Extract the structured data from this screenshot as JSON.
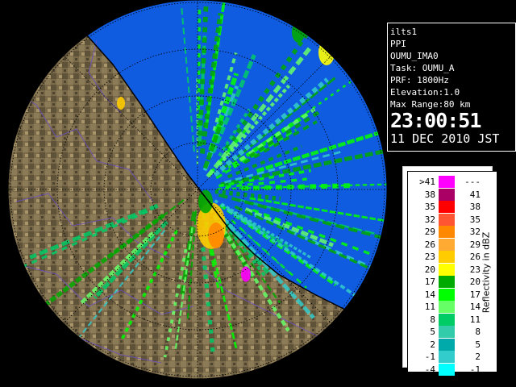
{
  "info": {
    "station": "ilts1",
    "product": "PPI",
    "site": "OUMU_IMA0",
    "task": "Task: OUMU_A",
    "prf": "PRF: 1800Hz",
    "elevation": "Elevation:1.0",
    "max_range": "Max Range:80 km",
    "time": "23:00:51",
    "date": "11 DEC 2010 JST"
  },
  "legend": {
    "unit": "Reflectivity in dBZ",
    "rows": [
      {
        "low": ">41",
        "high": "---",
        "color": "#ff00ff"
      },
      {
        "low": "38",
        "high": "41",
        "color": "#aa0066"
      },
      {
        "low": "35",
        "high": "38",
        "color": "#ff0000"
      },
      {
        "low": "32",
        "high": "35",
        "color": "#ff5533"
      },
      {
        "low": "29",
        "high": "32",
        "color": "#ff8800"
      },
      {
        "low": "26",
        "high": "29",
        "color": "#ffaa33"
      },
      {
        "low": "23",
        "high": "26",
        "color": "#ffcc00"
      },
      {
        "low": "20",
        "high": "23",
        "color": "#ffff00"
      },
      {
        "low": "17",
        "high": "20",
        "color": "#00aa00"
      },
      {
        "low": "14",
        "high": "17",
        "color": "#00ff00"
      },
      {
        "low": "11",
        "high": "14",
        "color": "#66ff66"
      },
      {
        "low": "8",
        "high": "11",
        "color": "#00cc66"
      },
      {
        "low": "5",
        "high": "8",
        "color": "#33ccaa"
      },
      {
        "low": "2",
        "high": "5",
        "color": "#00aaaa"
      },
      {
        "low": "-1",
        "high": "2",
        "color": "#33cccc"
      },
      {
        "low": "-4",
        "high": "-1",
        "color": "#00ffff"
      }
    ]
  },
  "colors": {
    "sea": "#0f5ce0",
    "land": "#7a6a4a",
    "range_rings": "#000000"
  }
}
